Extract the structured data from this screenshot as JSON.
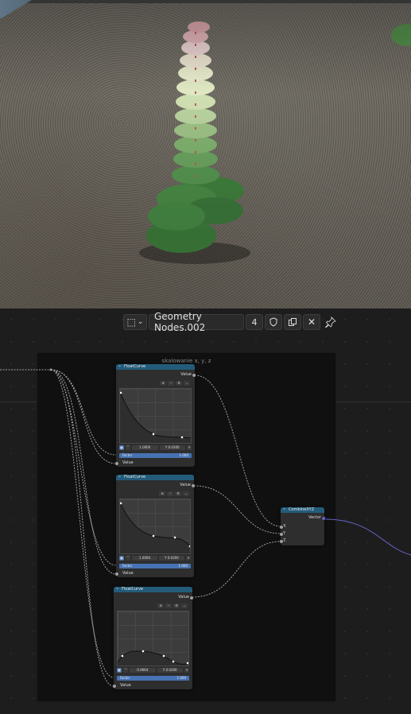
{
  "viewport": {
    "description_free": true
  },
  "header": {
    "editor_type_icon": "node-editor-icon",
    "datablock_name": "Geometry Nodes.002",
    "users_count": "4",
    "fake_user_icon": "shield-icon",
    "duplicate_icon": "duplicate-icon",
    "close_icon": "close-icon",
    "pin_icon": "pin-icon"
  },
  "frame": {
    "label": "skalowanie x, y, z"
  },
  "nodes": {
    "curve1": {
      "title": "FloatCurve",
      "output_label": "Value",
      "x_field": "1.0000",
      "y_field": "Y 0.0200",
      "factor_label": "Factor",
      "factor_value": "1.000",
      "input_label": "Value"
    },
    "curve2": {
      "title": "FloatCurve",
      "output_label": "Value",
      "x_field": "1.0000",
      "y_field": "Y 0.0200",
      "factor_label": "Factor",
      "factor_value": "1.000",
      "input_label": "Value"
    },
    "curve3": {
      "title": "FloatCurve",
      "output_label": "Value",
      "x_field": "0.0664",
      "y_field": "Y 0.0200",
      "factor_label": "Factor",
      "factor_value": "1.000",
      "input_label": "Value"
    },
    "combine": {
      "title": "CombineXYZ",
      "output_label": "Vector",
      "inputs": [
        "X",
        "Y",
        "Z"
      ]
    }
  },
  "colors": {
    "node_header": "#235c7a",
    "factor_bar": "#4772b3",
    "vector_wire": "#6363c7",
    "float_wire": "#a1a1a1"
  }
}
